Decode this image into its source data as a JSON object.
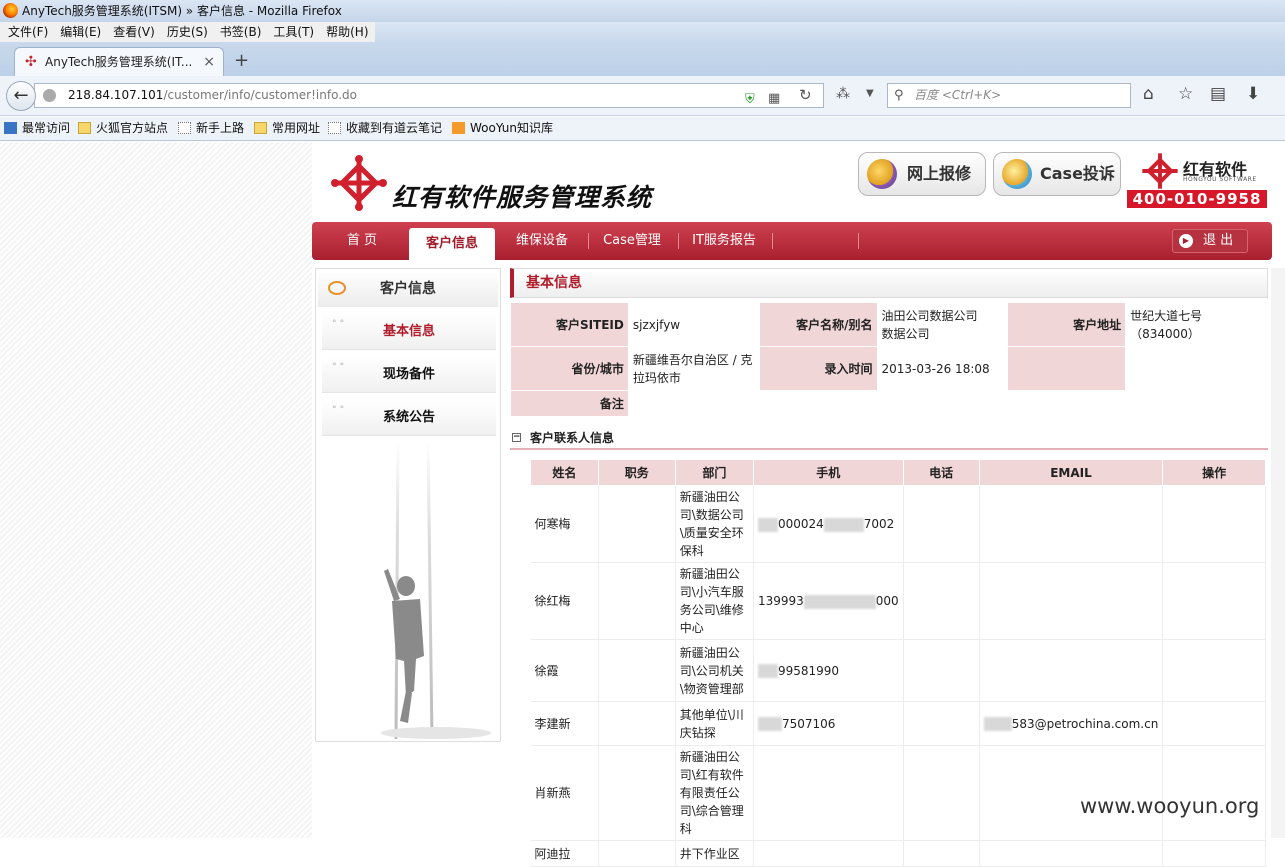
{
  "window": {
    "title": "AnyTech服务管理系统(ITSM) » 客户信息 - Mozilla Firefox"
  },
  "menu": [
    "文件(F)",
    "编辑(E)",
    "查看(V)",
    "历史(S)",
    "书签(B)",
    "工具(T)",
    "帮助(H)"
  ],
  "tab": {
    "title": "AnyTech服务管理系统(IT...",
    "close": "×",
    "new": "+"
  },
  "address": {
    "host": "218.84.107.101",
    "path": "/customer/info/customer!info.do"
  },
  "search": {
    "placeholder": "百度 <Ctrl+K>"
  },
  "bookmarks": [
    "最常访问",
    "火狐官方站点",
    "新手上路",
    "常用网址",
    "收藏到有道云笔记",
    "WooYun知识库"
  ],
  "header": {
    "system_name": "红有软件服务管理系统",
    "repair_label": "网上报修",
    "complain_label": "Case投诉",
    "brand_name": "红有软件",
    "brand_sub": "HONGYOU SOFTWARE",
    "phone": "400-010-9958"
  },
  "nav": {
    "items": [
      "首 页",
      "客户信息",
      "维保设备",
      "Case管理",
      "IT服务报告"
    ],
    "active_index": 1,
    "logout": "退 出"
  },
  "sidebar": {
    "title": "客户信息",
    "items": [
      "基本信息",
      "现场备件",
      "系统公告"
    ],
    "selected_index": 0
  },
  "basic": {
    "title": "基本信息",
    "siteid_label": "客户SITEID",
    "siteid": "sjzxjfyw",
    "name_label": "客户名称/别名",
    "name": "油田公司数据公司\n数据公司",
    "address_label": "客户地址",
    "address": "世纪大道七号\n（834000）",
    "province_label": "省份/城市",
    "province": "新疆维吾尔自治区 / 克拉玛依市",
    "entry_label": "录入时间",
    "entry": "2013-03-26 18:08",
    "remark_label": "备注",
    "remark": ""
  },
  "contacts": {
    "title": "客户联系人信息",
    "collapse_icon": "−",
    "columns": [
      "姓名",
      "职务",
      "部门",
      "手机",
      "电话",
      "EMAIL",
      "操作"
    ],
    "rows": [
      {
        "name": "何寒梅",
        "title": "",
        "dept": "新疆油田公司\\数据公司\\质量安全环保科",
        "mobile": "000024",
        "mobile_suffix": "7002",
        "phone": "",
        "email": ""
      },
      {
        "name": "徐红梅",
        "title": "",
        "dept": "新疆油田公司\\小汽车服务公司\\维修中心",
        "mobile": "139993",
        "mobile_suffix": "000",
        "phone": "",
        "email": ""
      },
      {
        "name": "徐霞",
        "title": "",
        "dept": "新疆油田公司\\公司机关\\物资管理部",
        "mobile": "99581990",
        "mobile_suffix": "",
        "phone": "",
        "email": ""
      },
      {
        "name": "李建新",
        "title": "",
        "dept": "其他单位\\川庆钻探",
        "mobile": "7507106",
        "mobile_suffix": "",
        "phone": "",
        "email": "583@petrochina.com.cn"
      },
      {
        "name": "肖新燕",
        "title": "",
        "dept": "新疆油田公司\\红有软件有限责任公司\\综合管理科",
        "mobile": "",
        "mobile_suffix": "",
        "phone": "",
        "email": ""
      },
      {
        "name": "阿迪拉",
        "title": "",
        "dept": "井下作业区",
        "mobile": "",
        "mobile_suffix": "",
        "phone": "",
        "email": ""
      }
    ]
  },
  "watermark": "www.wooyun.org"
}
